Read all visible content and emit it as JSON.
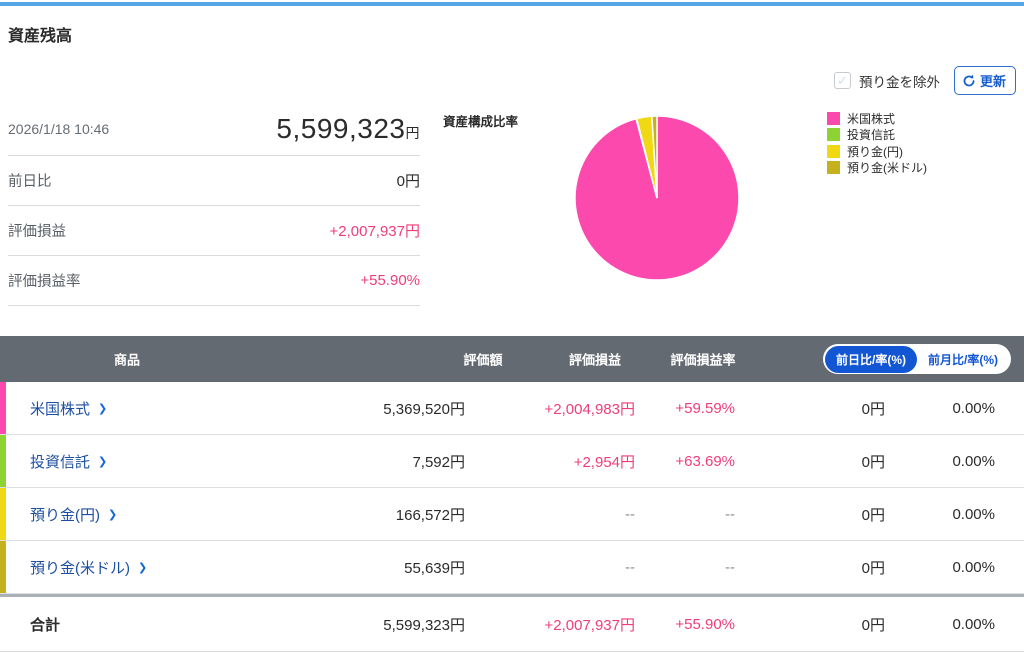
{
  "page": {
    "title": "資産残高"
  },
  "controls": {
    "exclude_label": "預り金を除外",
    "refresh_label": "更新"
  },
  "summary": {
    "as_of": "2026/1/18 10:46",
    "total_amount": "5,599,323",
    "total_unit": "円",
    "rows": [
      {
        "label": "前日比",
        "value": "0円"
      },
      {
        "label": "評価損益",
        "value": "+2,007,937円"
      },
      {
        "label": "評価損益率",
        "value": "+55.90%"
      }
    ]
  },
  "chart_data": {
    "type": "pie",
    "title": "資産構成比率",
    "labels": [
      "米国株式",
      "投資信託",
      "預り金(円)",
      "預り金(米ドル)"
    ],
    "values": [
      5369520,
      7592,
      166572,
      55639
    ],
    "percents": [
      95.9,
      0.14,
      2.97,
      0.99
    ],
    "colors": [
      "#fb49ae",
      "#8ed334",
      "#f0d814",
      "#c4b11d"
    ],
    "legend_position": "right",
    "start_angle": "top",
    "direction": "clockwise"
  },
  "table": {
    "headers": [
      "商品",
      "評価額",
      "評価損益",
      "評価損益率"
    ],
    "toggle": {
      "active_label": "前日比/率(%)",
      "inactive_label": "前月比/率(%)"
    },
    "rows": [
      {
        "label": "米国株式",
        "color": "#fb49ae",
        "valuation": "5,369,520円",
        "pl": "+2,004,983円",
        "pl_rate": "+59.59%",
        "day_change": "0円",
        "day_rate": "0.00%"
      },
      {
        "label": "投資信託",
        "color": "#8ed334",
        "valuation": "7,592円",
        "pl": "+2,954円",
        "pl_rate": "+63.69%",
        "day_change": "0円",
        "day_rate": "0.00%"
      },
      {
        "label": "預り金(円)",
        "color": "#f0d814",
        "valuation": "166,572円",
        "pl": "--",
        "pl_rate": "--",
        "day_change": "0円",
        "day_rate": "0.00%"
      },
      {
        "label": "預り金(米ドル)",
        "color": "#c4b11d",
        "valuation": "55,639円",
        "pl": "--",
        "pl_rate": "--",
        "day_change": "0円",
        "day_rate": "0.00%"
      }
    ],
    "total": {
      "label": "合計",
      "valuation": "5,599,323円",
      "pl": "+2,007,937円",
      "pl_rate": "+55.90%",
      "day_change": "0円",
      "day_rate": "0.00%"
    }
  },
  "colors": {
    "top_accent": "#55a7e8",
    "header_gray": "#646a72",
    "toggle_blue": "#1356d4",
    "profit_pink": "#ee3d78",
    "link_blue": "#1d4fa1"
  }
}
